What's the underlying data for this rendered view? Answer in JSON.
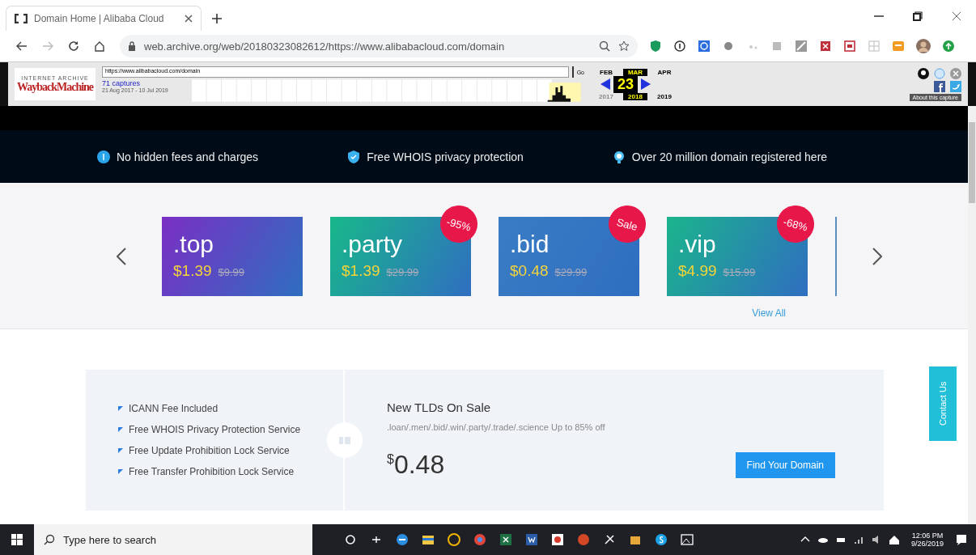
{
  "browser": {
    "tab": {
      "title": "Domain Home | Alibaba Cloud",
      "selected": true
    },
    "url": "web.archive.org/web/20180323082612/https://www.alibabacloud.com/domain"
  },
  "wayback": {
    "logo_top": "INTERNET ARCHIVE",
    "logo": "WaybackMachine",
    "url_field": "https://www.alibabacloud.com/domain",
    "go": "Go",
    "captures": "71 captures",
    "date_range": "21 Aug 2017 - 10 Jul 2019",
    "day": "23",
    "about": "About this capture",
    "months": [
      {
        "label": "FEB",
        "selected": false
      },
      {
        "label": "MAR",
        "selected": true
      },
      {
        "label": "APR",
        "selected": false
      }
    ],
    "years": [
      {
        "label": "2017",
        "selected": false,
        "disabled": true
      },
      {
        "label": "2018",
        "selected": true,
        "disabled": false
      },
      {
        "label": "2019",
        "selected": false,
        "disabled": false
      }
    ]
  },
  "features": [
    {
      "kind": "coin",
      "text": "No hidden fees and charges"
    },
    {
      "kind": "shield",
      "text": "Free WHOIS privacy protection"
    },
    {
      "kind": "bulb",
      "text": "Over 20 million domain registered here"
    }
  ],
  "domains": [
    {
      "name": ".top",
      "price": "$1.39",
      "old_price": "$9.99",
      "color": "#7a2fc4"
    },
    {
      "name": ".party",
      "price": "$1.39",
      "old_price": "$29.99",
      "badge": "-95%",
      "color": "#18b88a"
    },
    {
      "name": ".bid",
      "price": "$0.48",
      "old_price": "$29.99",
      "badge": "Sale",
      "color": "#3a7cc4"
    },
    {
      "name": ".vip",
      "price": "$4.99",
      "old_price": "$15.99",
      "badge": "-68%",
      "color": "#1bb48c"
    }
  ],
  "view_all": "View All",
  "promo": {
    "features": [
      "ICANN Fee Included",
      "Free WHOIS Privacy Protection Service",
      "Free Update Prohibition Lock Service",
      "Free Transfer Prohibition Lock Service"
    ],
    "title": "New TLDs On Sale",
    "subtitle": ".loan/.men/.bid/.win/.party/.trade/.science Up to 85% off",
    "currency": "$",
    "price": "0.48",
    "button": "Find Your Domain"
  },
  "contact": "Contact Us",
  "taskbar": {
    "search_placeholder": "Type here to search",
    "time": "12:06 PM",
    "date": "9/26/2019"
  }
}
